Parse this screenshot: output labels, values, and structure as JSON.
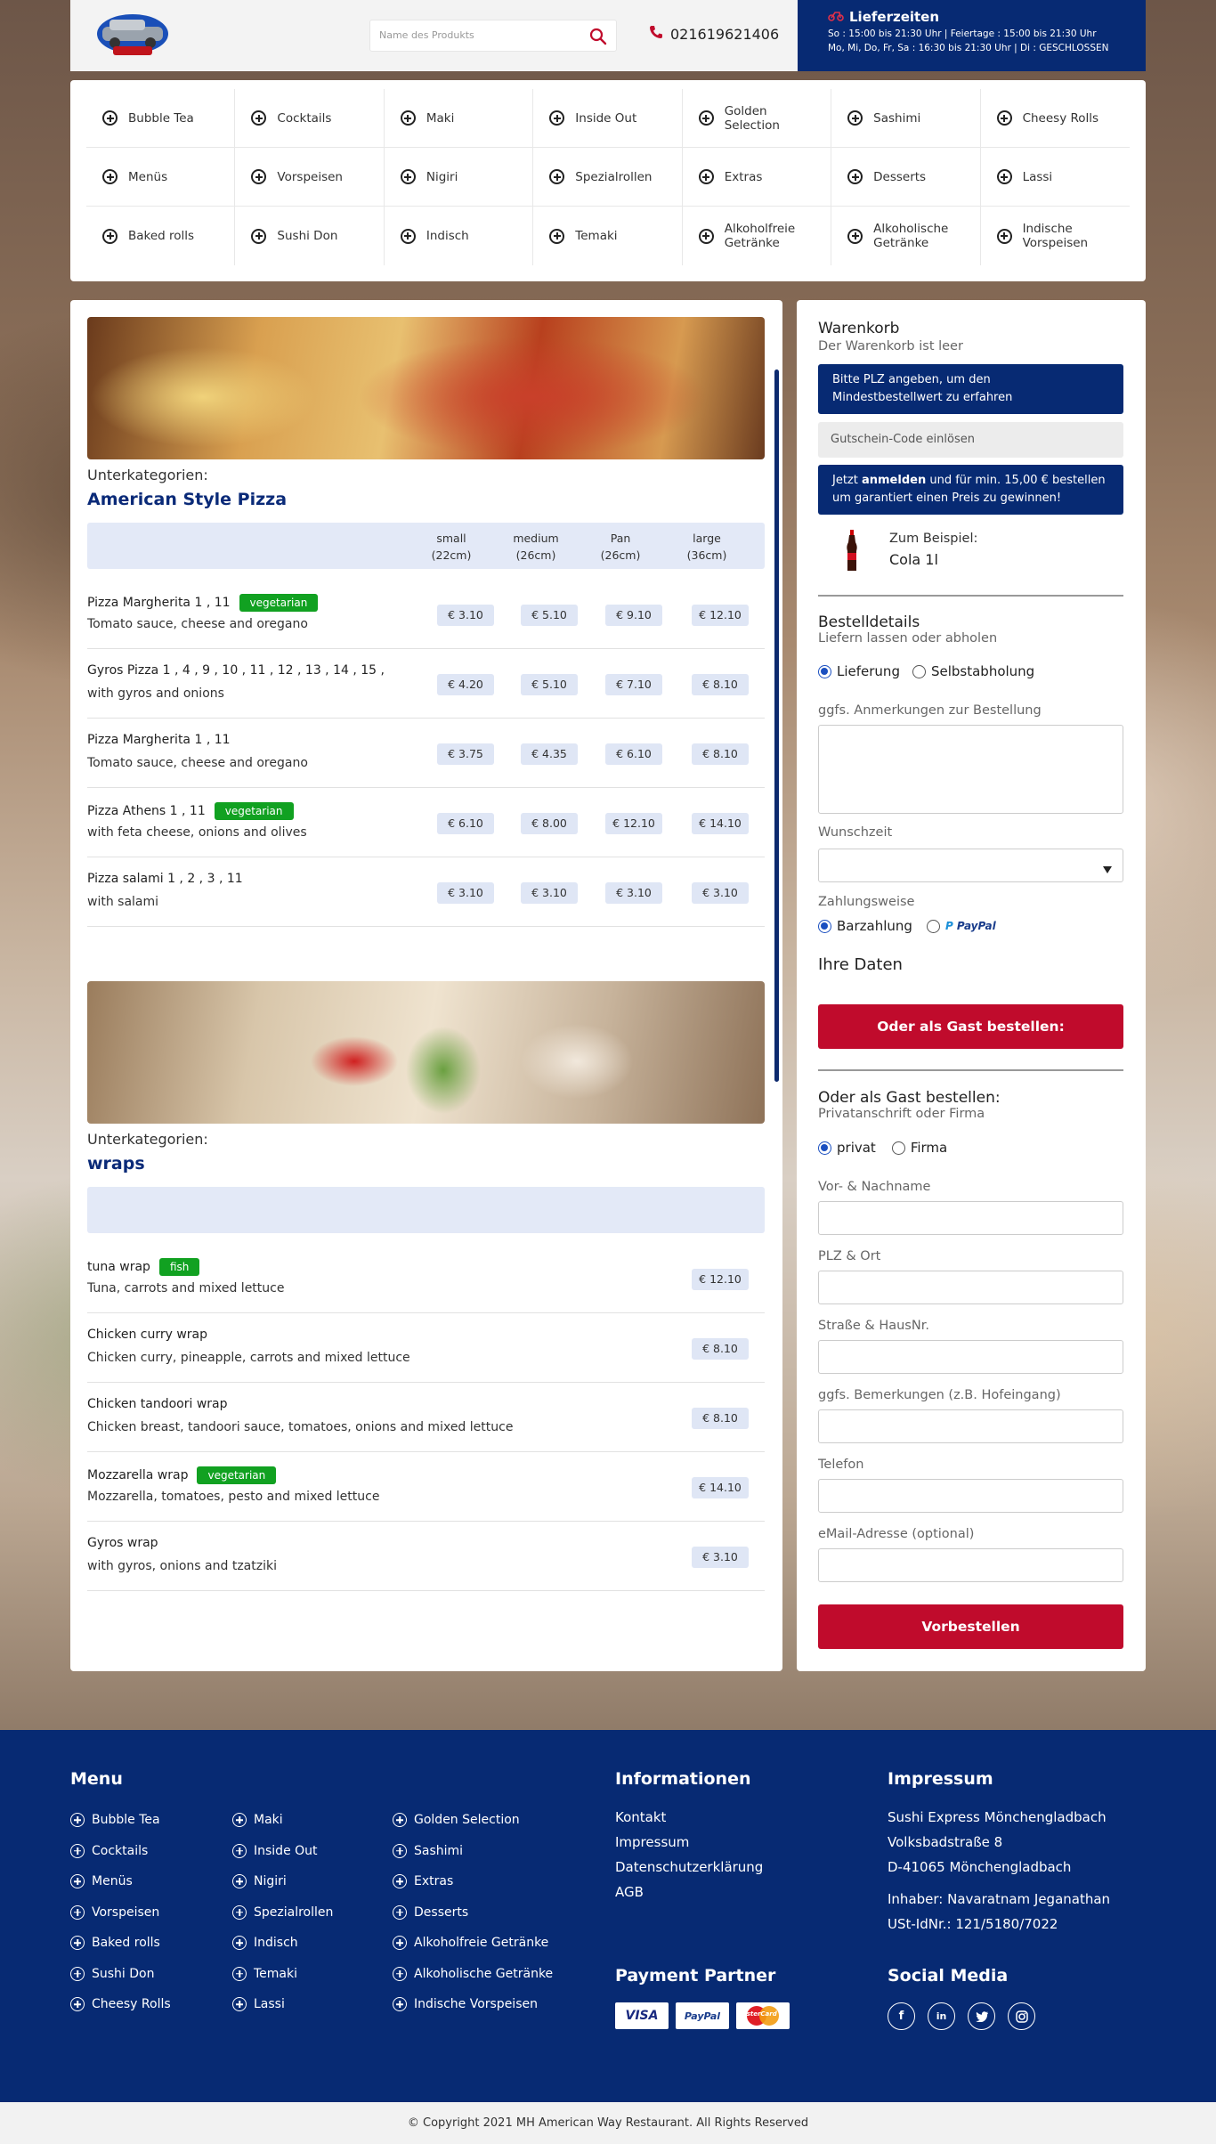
{
  "header": {
    "logo_text": "Restaurant Logo",
    "search_placeholder": "Name des Produkts",
    "phone": "021619621406",
    "hours_title": "Lieferzeiten",
    "hours_row1": "So : 15:00 bis 21:30 Uhr  |  Feiertage : 15:00 bis 21:30 Uhr",
    "hours_row2": "Mo, Mi, Do, Fr, Sa : 16:30 bis 21:30 Uhr  |  Di : GESCHLOSSEN"
  },
  "categories": [
    "Bubble Tea",
    "Cocktails",
    "Maki",
    "Inside Out",
    "Golden Selection",
    "Sashimi",
    "Cheesy Rolls",
    "Menüs",
    "Vorspeisen",
    "Nigiri",
    "Spezialrollen",
    "Extras",
    "Desserts",
    "Lassi",
    "Baked rolls",
    "Sushi Don",
    "Indisch",
    "Temaki",
    "Alkoholfreie Getränke",
    "Alkoholische Getränke",
    "Indische Vorspeisen"
  ],
  "sections": [
    {
      "label": "Unterkategorien:",
      "title": "American Style Pizza",
      "columns": [
        "small (22cm)",
        "medium (26cm)",
        "Pan (26cm)",
        "large (36cm)"
      ],
      "items": [
        {
          "name": "Pizza Margherita 1 , 11",
          "tag": "vegetarian",
          "desc": "Tomato sauce, cheese and oregano",
          "prices": [
            "€ 3.10",
            "€ 5.10",
            "€ 9.10",
            "€ 12.10"
          ]
        },
        {
          "name": "Gyros Pizza 1 , 4 , 9 , 10 , 11 , 12 , 13 , 14 , 15 ,",
          "tag": "",
          "desc": "with gyros and onions",
          "prices": [
            "€ 4.20",
            "€ 5.10",
            "€ 7.10",
            "€ 8.10"
          ]
        },
        {
          "name": "Pizza Margherita 1 , 11",
          "tag": "",
          "desc": "Tomato sauce, cheese and oregano",
          "prices": [
            "€ 3.75",
            "€ 4.35",
            "€ 6.10",
            "€ 8.10"
          ]
        },
        {
          "name": "Pizza Athens 1 , 11",
          "tag": "vegetarian",
          "desc": "with feta cheese, onions and olives",
          "prices": [
            "€ 6.10",
            "€ 8.00",
            "€ 12.10",
            "€ 14.10"
          ]
        },
        {
          "name": "Pizza salami 1 , 2 , 3 , 11",
          "tag": "",
          "desc": "with salami",
          "prices": [
            "€ 3.10",
            "€ 3.10",
            "€ 3.10",
            "€ 3.10"
          ]
        }
      ]
    },
    {
      "label": "Unterkategorien:",
      "title": "wraps",
      "items": [
        {
          "name": "tuna wrap",
          "tag": "fish",
          "desc": "Tuna, carrots and mixed lettuce",
          "price": "€ 12.10"
        },
        {
          "name": "Chicken curry wrap",
          "tag": "",
          "desc": "Chicken curry, pineapple, carrots and mixed lettuce",
          "price": "€ 8.10"
        },
        {
          "name": "Chicken tandoori wrap",
          "tag": "",
          "desc": "Chicken breast, tandoori sauce, tomatoes, onions and mixed lettuce",
          "price": "€ 8.10"
        },
        {
          "name": "Mozzarella wrap",
          "tag": "vegetarian",
          "desc": "Mozzarella, tomatoes, pesto and mixed lettuce",
          "price": "€ 14.10"
        },
        {
          "name": "Gyros wrap",
          "tag": "",
          "desc": "with gyros, onions and tzatziki",
          "price": "€ 3.10"
        }
      ]
    }
  ],
  "cart": {
    "title": "Warenkorb",
    "empty": "Der Warenkorb ist leer",
    "plz_notice_1": "Bitte PLZ angeben, um den",
    "plz_notice_2": "Mindestbestellwert zu erfahren",
    "voucher": "Gutschein-Code einlösen",
    "promo_a": "Jetzt ",
    "promo_b": "anmelden",
    "promo_c": " und für min. 15,00 € bestellen",
    "promo_d": "um garantiert einen Preis zu  gewinnen!",
    "example_label": "Zum Beispiel:",
    "example_item": "Cola 1l",
    "order_title": "Bestelldetails",
    "order_sub": "Liefern lassen oder abholen",
    "delivery": "Lieferung",
    "pickup": "Selbstabholung",
    "notes_label": "ggfs. Anmerkungen zur Bestellung",
    "time_label": "Wunschzeit",
    "pay_label": "Zahlungsweise",
    "cash": "Barzahlung",
    "paypal": "PayPal",
    "your_data": "Ihre Daten",
    "guest_btn": "Oder als Gast bestellen:",
    "guest_title": "Oder als Gast bestellen:",
    "guest_sub": "Privatanschrift oder Firma",
    "private": "privat",
    "company": "Firma",
    "f_name": "Vor- & Nachname",
    "f_plz": "PLZ & Ort",
    "f_street": "Straße & HausNr.",
    "f_remarks": "ggfs. Bemerkungen (z.B. Hofeingang)",
    "f_phone": "Telefon",
    "f_email": "eMail-Adresse (optional)",
    "submit": "Vorbestellen"
  },
  "footer": {
    "menu_title": "Menu",
    "menu_col1": [
      "Bubble Tea",
      "Cocktails",
      "Menüs",
      "Vorspeisen",
      "Baked rolls",
      "Sushi Don",
      "Cheesy Rolls"
    ],
    "menu_col2": [
      "Maki",
      "Inside Out",
      "Nigiri",
      "Spezialrollen",
      "Indisch",
      "Temaki",
      "Lassi"
    ],
    "menu_col3": [
      "Golden Selection",
      "Sashimi",
      "Extras",
      "Desserts",
      "Alkoholfreie Getränke",
      "Alkoholische Getränke",
      "Indische Vorspeisen"
    ],
    "info_title": "Informationen",
    "info_links": [
      "Kontakt",
      "Impressum",
      "Datenschutzerklärung",
      "AGB"
    ],
    "imprint_title": "Impressum",
    "imprint": [
      "Sushi Express Mönchengladbach",
      "Volksbadstraße 8",
      "D-41065 Mönchengladbach",
      "Inhaber: Navaratnam Jeganathan",
      "USt-IdNr.: 121/5180/7022"
    ],
    "payment_title": "Payment Partner",
    "payments": [
      "VISA",
      "PayPal",
      "MasterCard"
    ],
    "social_title": "Social Media",
    "social": [
      "f",
      "in",
      "t",
      "ig"
    ],
    "copyright": "© Copyright 2021 MH American Way Restaurant. All Rights Reserved"
  },
  "colors": {
    "navy": "#072a73",
    "red": "#c00b2c",
    "green": "#11a121",
    "price_bg": "#dfe6f5"
  }
}
